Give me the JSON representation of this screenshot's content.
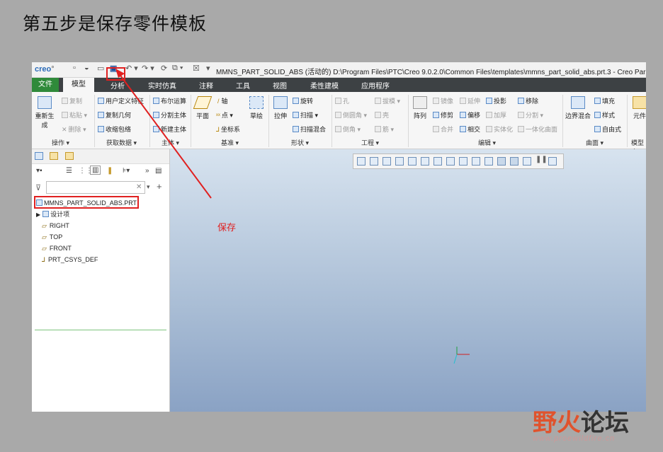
{
  "heading": "第五步是保存零件模板",
  "annotation": {
    "label": "保存",
    "color": "#e02020"
  },
  "titlebar": {
    "logo": "creo",
    "logo_mark": "°",
    "window_title": "MMNS_PART_SOLID_ABS (活动的) D:\\Program Files\\PTC\\Creo 9.0.2.0\\Common Files\\templates\\mmns_part_solid_abs.prt.3 - Creo Paramet"
  },
  "menu": {
    "file": "文件",
    "tabs": [
      "模型",
      "分析",
      "实时仿真",
      "注释",
      "工具",
      "视图",
      "柔性建模",
      "应用程序"
    ]
  },
  "ribbon": {
    "regen": "重新生成",
    "copy": "复制",
    "paste": "粘贴",
    "delete": "删除",
    "user_feature": "用户定义特征",
    "copy_geom": "复制几何",
    "shrinkwrap": "收缩包络",
    "boolean": "布尔运算",
    "split_body": "分割主体",
    "new_body": "新建主体",
    "plane": "平面",
    "axis": "轴",
    "point": "点",
    "csys": "坐标系",
    "sketch": "草绘",
    "extrude": "拉伸",
    "revolve": "旋转",
    "sweep": "扫描",
    "swept_blend": "扫描混合",
    "hole": "孔",
    "round": "倒圆角",
    "chamfer": "倒角",
    "draft": "拔模",
    "shell": "壳",
    "rib": "筋",
    "pattern": "阵列",
    "mirror": "镜像",
    "extend": "延伸",
    "project": "投影",
    "trim": "修剪",
    "offset": "偏移",
    "thicken": "加厚",
    "merge": "合并",
    "intersect": "相交",
    "solidify": "实体化",
    "move": "移除",
    "split": "分割",
    "unify_surf": "一体化曲面",
    "boundary_blend": "边界混合",
    "fill": "填充",
    "style": "样式",
    "freestyle": "自由式",
    "component": "元件",
    "groups": [
      "操作",
      "获取数据",
      "主体",
      "基准",
      "形状",
      "工程",
      "编辑",
      "曲面",
      "模型意"
    ]
  },
  "tree": {
    "root": "MMNS_PART_SOLID_ABS.PRT",
    "items": [
      "设计项",
      "RIGHT",
      "TOP",
      "FRONT",
      "PRT_CSYS_DEF"
    ]
  },
  "watermark": {
    "brand_a": "野火",
    "brand_b": "论坛",
    "url": "www.proewildfire.cn"
  }
}
